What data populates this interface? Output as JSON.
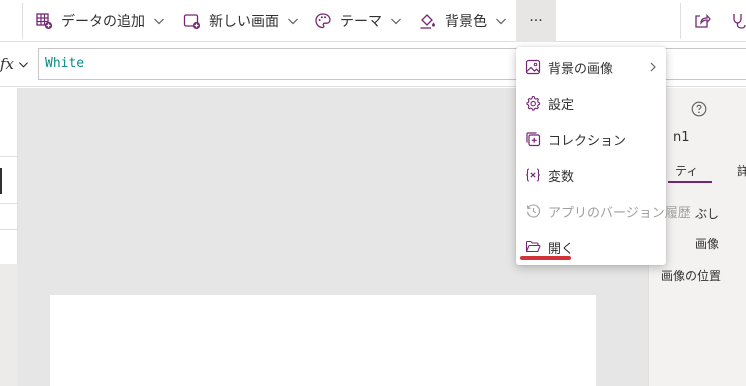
{
  "toolbar": {
    "add_data_label": "データの追加",
    "new_screen_label": "新しい画面",
    "theme_label": "テーマ",
    "background_color_label": "背景色",
    "more_label": "···"
  },
  "formula_bar": {
    "fx_label": "fx",
    "value": "White"
  },
  "menu": {
    "items": [
      {
        "label": "背景の画像",
        "icon": "image-icon"
      },
      {
        "label": "設定",
        "icon": "gear-icon"
      },
      {
        "label": "コレクション",
        "icon": "collection-icon"
      },
      {
        "label": "変数",
        "icon": "variable-icon"
      },
      {
        "label": "アプリのバージョン履歴",
        "icon": "history-icon"
      },
      {
        "label": "開く",
        "icon": "folder-open-icon"
      }
    ]
  },
  "property_panel": {
    "screen_name_fragment": "n1",
    "tab_properties_fragment": "ティ",
    "tab_advanced_fragment": "詳",
    "row_fill_fragment": "ぶし",
    "row_background_image_fragment": "画像",
    "row_image_position": "画像の位置"
  },
  "colors": {
    "accent_purple": "#742774",
    "formula_text": "#0b8a8a",
    "highlight_red": "#d13438"
  }
}
